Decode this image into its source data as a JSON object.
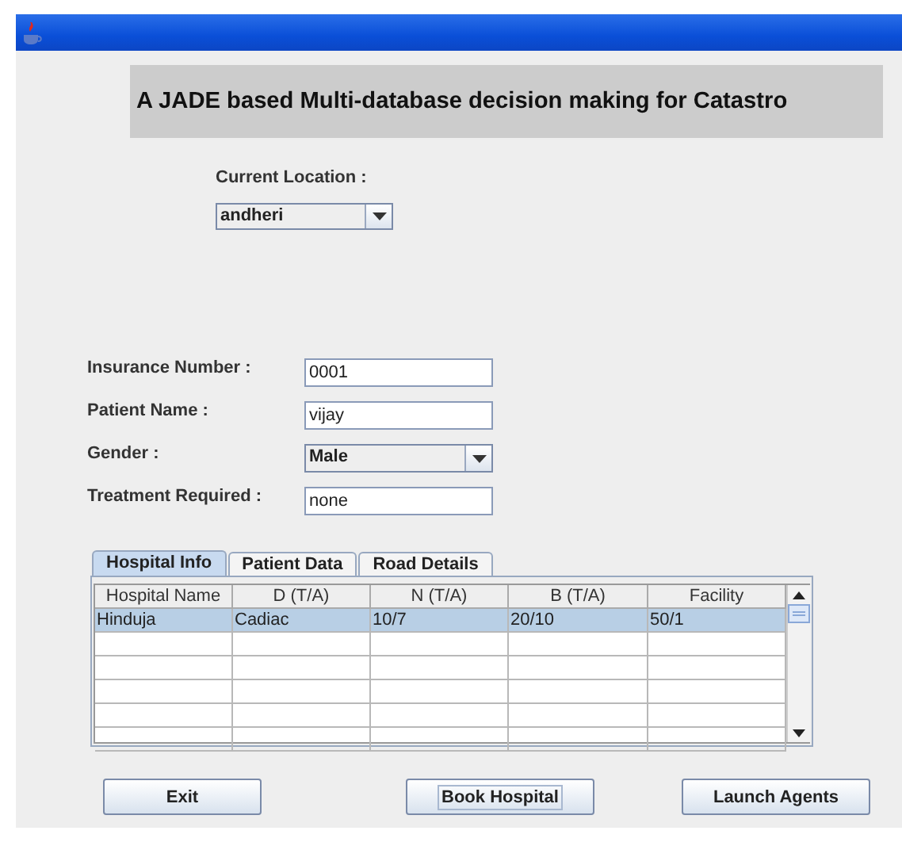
{
  "banner": {
    "title": "A JADE based Multi-database decision making for Catastro"
  },
  "location": {
    "label": "Current Location :",
    "value": "andheri"
  },
  "form": [
    {
      "kind": "text",
      "label": "Insurance Number :",
      "value": "0001"
    },
    {
      "kind": "text",
      "label": "Patient Name :",
      "value": "vijay"
    },
    {
      "kind": "combo",
      "label": "Gender :",
      "value": "Male"
    },
    {
      "kind": "text",
      "label": "Treatment Required :",
      "value": "none"
    }
  ],
  "tabs": [
    {
      "label": "Hospital Info",
      "selected": true
    },
    {
      "label": "Patient Data",
      "selected": false
    },
    {
      "label": "Road Details",
      "selected": false
    }
  ],
  "table": {
    "columns": [
      "Hospital Name",
      "D (T/A)",
      "N (T/A)",
      "B (T/A)",
      "Facility"
    ],
    "rows": [
      {
        "cells": [
          "Hinduja",
          "Cadiac",
          "10/7",
          "20/10",
          "50/1"
        ],
        "selected": true
      }
    ]
  },
  "buttons": [
    {
      "label": "Exit",
      "focused": false
    },
    {
      "label": "Book Hospital",
      "focused": true
    },
    {
      "label": "Launch Agents",
      "focused": false
    }
  ]
}
